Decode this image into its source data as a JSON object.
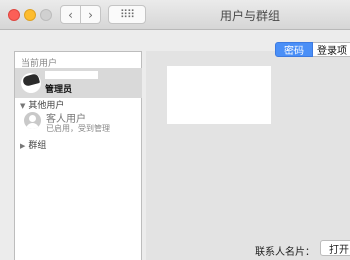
{
  "window": {
    "title": "用户与群组",
    "grid_glyph": "⠿⠿"
  },
  "nav": {
    "back_glyph": "‹",
    "forward_glyph": "›"
  },
  "sidebar": {
    "current_section_label": "当前用户",
    "current_user": {
      "name": "管理员"
    },
    "other_users_label": "其他用户",
    "guest": {
      "name": "客人用户",
      "status": "已启用，受到管理"
    },
    "groups_label": "群组",
    "expanded_glyph": "▼",
    "collapsed_glyph": "▶"
  },
  "tabs": [
    {
      "label": "密码",
      "active": true
    },
    {
      "label": "登录项",
      "active": false
    }
  ],
  "main": {
    "contact_card_label": "联系人名片：",
    "open_button_label": "打开"
  },
  "colors": {
    "accent": "#4a8ff7",
    "close": "#fc5f57",
    "minimize": "#fdbc2e"
  }
}
